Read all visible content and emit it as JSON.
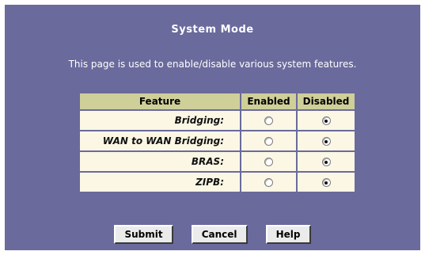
{
  "page": {
    "title": "System Mode",
    "description": "This page is used to enable/disable various system features."
  },
  "table": {
    "headers": [
      "Feature",
      "Enabled",
      "Disabled"
    ],
    "rows": [
      {
        "label": "Bridging:",
        "selected": "Disabled"
      },
      {
        "label": "WAN to WAN Bridging:",
        "selected": "Disabled"
      },
      {
        "label": "BRAS:",
        "selected": "Disabled"
      },
      {
        "label": "ZIPB:",
        "selected": "Disabled"
      }
    ]
  },
  "buttons": {
    "submit": "Submit",
    "cancel": "Cancel",
    "help": "Help"
  },
  "colors": {
    "panel_background": "#6a6a9d",
    "header_background": "#cfcf9a",
    "row_background": "#fbf7e4"
  }
}
